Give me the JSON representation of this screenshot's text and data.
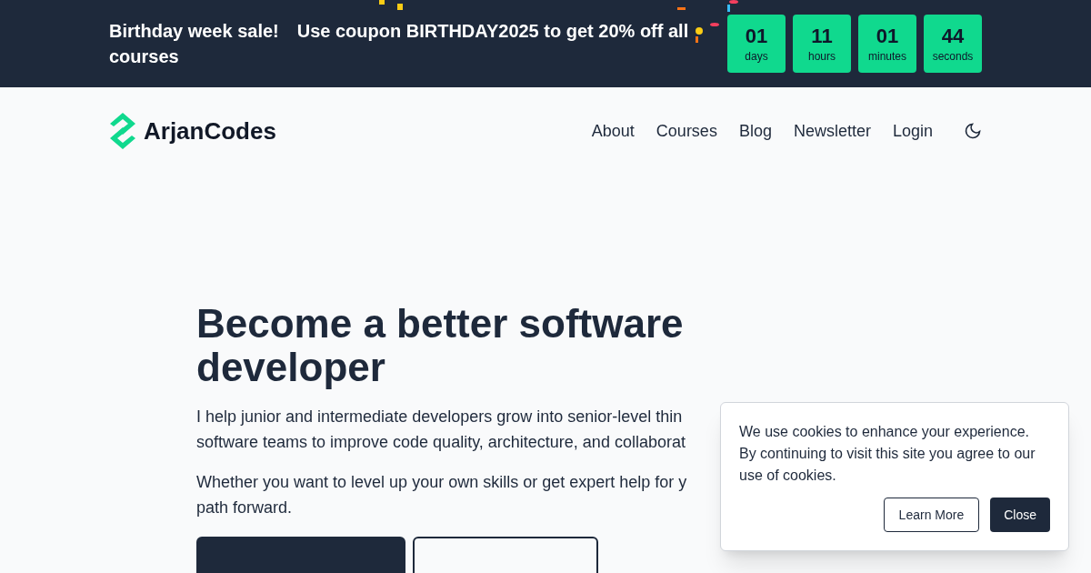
{
  "banner": {
    "title": "Birthday week sale!",
    "message": "Use coupon BIRTHDAY2025 to get 20% off all courses",
    "countdown": [
      {
        "value": "01",
        "unit": "days"
      },
      {
        "value": "11",
        "unit": "hours"
      },
      {
        "value": "01",
        "unit": "minutes"
      },
      {
        "value": "44",
        "unit": "seconds"
      }
    ]
  },
  "header": {
    "logo": "ArjanCodes",
    "nav": [
      "About",
      "Courses",
      "Blog",
      "Newsletter",
      "Login"
    ]
  },
  "hero": {
    "heading": "Become a better software developer",
    "paragraphs": [
      [
        "I help junior and intermediate developers grow into senior-level thin",
        "software teams to improve code quality, architecture, and collaborat"
      ],
      [
        "Whether you want to level up your own skills or get expert help for y",
        "path forward."
      ]
    ]
  },
  "cookie": {
    "message": "We use cookies to enhance your experience. By continuing to visit this site you agree to our use of cookies.",
    "buttons": [
      {
        "label": "Learn More",
        "kind": "outline"
      },
      {
        "label": "Close",
        "kind": "solid"
      }
    ]
  }
}
